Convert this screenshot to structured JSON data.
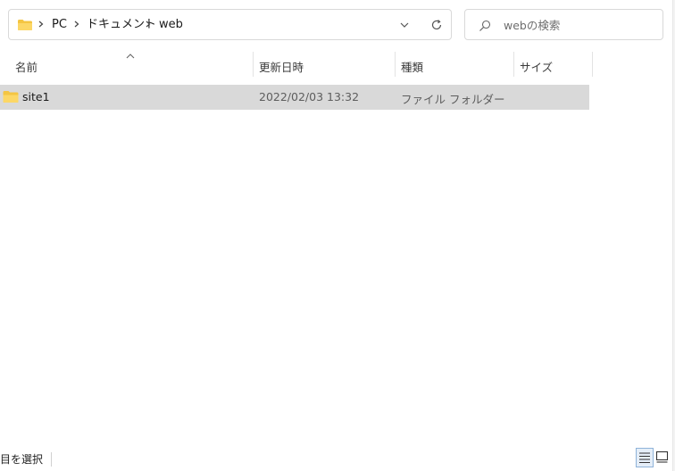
{
  "breadcrumb": {
    "items": [
      {
        "label": "PC"
      },
      {
        "label": "ドキュメント"
      },
      {
        "label": "web"
      }
    ],
    "icons": {
      "folder": "folder-icon",
      "separator": "chevron-right-icon",
      "dropdown": "chevron-down-icon",
      "refresh": "refresh-icon"
    }
  },
  "search": {
    "placeholder": "webの検索",
    "icon": "search-icon"
  },
  "columns": [
    {
      "label": "名前"
    },
    {
      "label": "更新日時"
    },
    {
      "label": "種類"
    },
    {
      "label": "サイズ"
    }
  ],
  "sort": {
    "column": "名前",
    "direction": "ascending",
    "icon": "sort-up-icon"
  },
  "files": [
    {
      "name": "site1",
      "modified": "2022/02/03 13:32",
      "type": "ファイル フォルダー",
      "size": "",
      "selected": true,
      "icon": "folder-icon"
    }
  ],
  "status": {
    "text": "目を選択"
  },
  "view_modes": {
    "details_icon": "details-view-icon",
    "large_icon": "large-icons-view-icon",
    "active": "details"
  },
  "colors": {
    "folder": "#F4C542",
    "selected_row": "#D9D9D9",
    "border": "#D9D9D9",
    "active_view_border": "#8FB3D9"
  }
}
